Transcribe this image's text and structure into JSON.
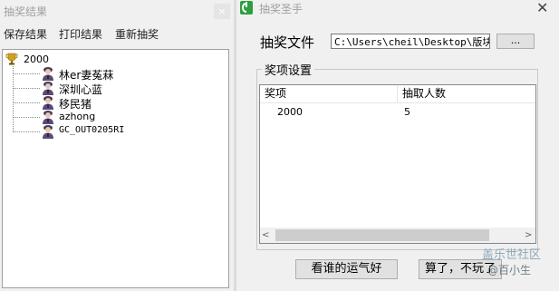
{
  "left_window": {
    "title": "抽奖结果",
    "close_glyph": "×",
    "menu": [
      "保存结果",
      "打印结果",
      "重新抽奖"
    ],
    "tree": {
      "root": "2000",
      "winners": [
        "林er妻菟菻",
        "深圳心蓝",
        "移民猪",
        "azhong",
        "GC_OUT0205RI"
      ]
    }
  },
  "right_window": {
    "title": "抽奖圣手",
    "close_glyph": "✕",
    "file_label": "抽奖文件",
    "file_path": "C:\\Users\\cheil\\Desktop\\版块活",
    "browse_label": "...",
    "group_title": "奖项设置",
    "columns": [
      "奖项",
      "抽取人数"
    ],
    "rows": [
      [
        "2000",
        "5"
      ]
    ],
    "scroll_left": "<",
    "scroll_right": ">",
    "draw_button": "看谁的运气好",
    "cancel_button": "算了，不玩了"
  },
  "watermark": {
    "line1": "盖乐世社区",
    "line2": "@百小生"
  },
  "icons": {
    "trophy": "trophy-icon",
    "winner": "user-avatar-icon",
    "app": "app-icon"
  },
  "colors": {
    "window_bg": "#f0f0f0",
    "title_text": "#a0a0a0",
    "app_icon_green": "#2e9e3e"
  }
}
